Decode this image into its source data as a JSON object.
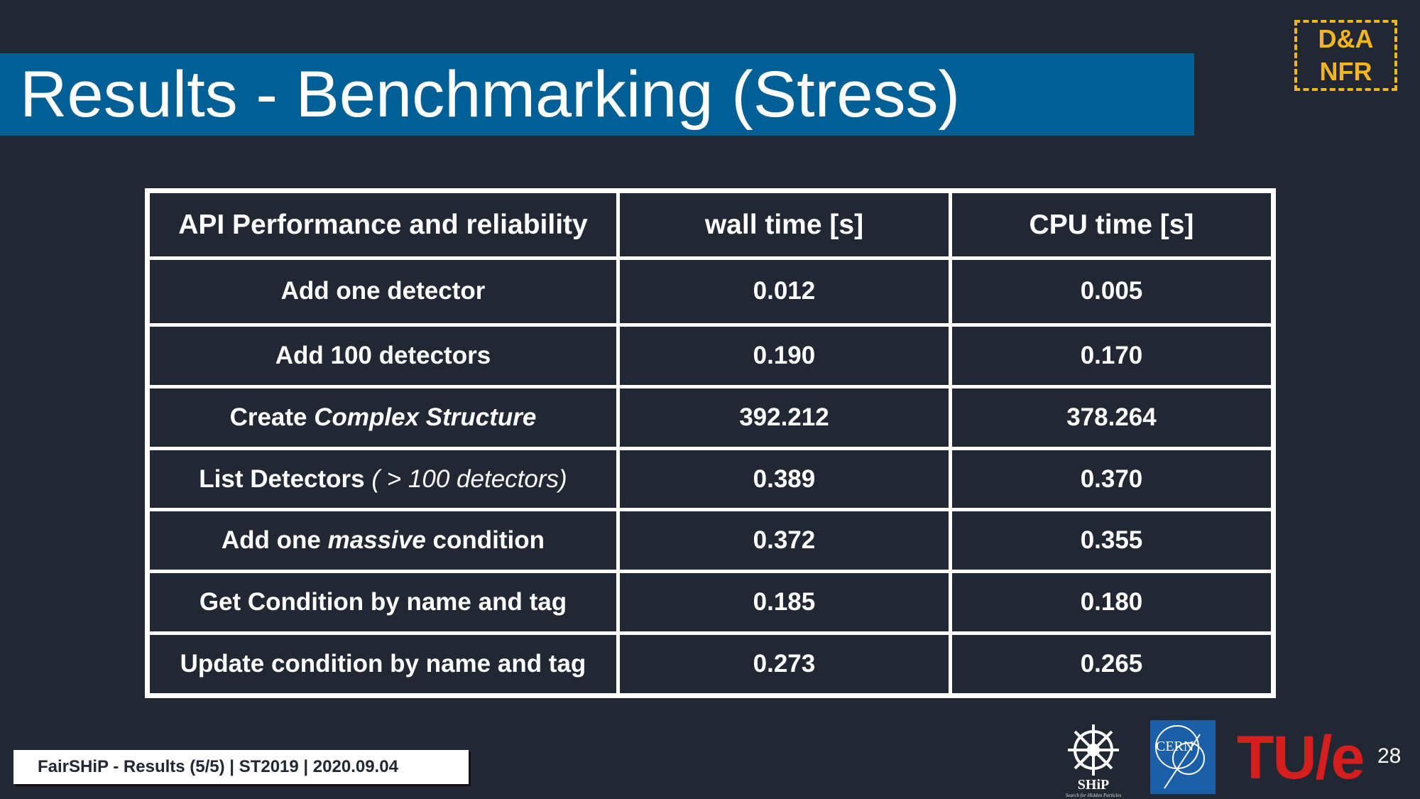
{
  "slide": {
    "title": "Results - Benchmarking (Stress)",
    "badge": {
      "line1": "D&A",
      "line2": "NFR"
    },
    "footer": "FairSHiP - Results (5/5) | ST2019 | 2020.09.04",
    "page_number": "28",
    "colors": {
      "background": "#222833",
      "title_bar": "#005f94",
      "badge": "#f2b51d",
      "tue_red": "#d61e1e",
      "cern_blue": "#1b5fa8"
    }
  },
  "table": {
    "headers": [
      "API Performance and reliability",
      "wall time [s]",
      "CPU time [s]"
    ],
    "rows": [
      {
        "label_parts": [
          "Add one detector"
        ],
        "wall": "0.012",
        "cpu": "0.005"
      },
      {
        "label_parts": [
          "Add 100 detectors"
        ],
        "wall": "0.190",
        "cpu": "0.170"
      },
      {
        "label_parts": [
          "Create ",
          "Complex Structure"
        ],
        "wall": "392.212",
        "cpu": "378.264"
      },
      {
        "label_parts": [
          "List Detectors ",
          "( > 100 detectors)"
        ],
        "wall": "0.389",
        "cpu": "0.370"
      },
      {
        "label_parts": [
          "Add one ",
          "massive",
          " condition"
        ],
        "wall": "0.372",
        "cpu": "0.355"
      },
      {
        "label_parts": [
          "Get Condition by name and tag"
        ],
        "wall": "0.185",
        "cpu": "0.180"
      },
      {
        "label_parts": [
          "Update condition by name and tag"
        ],
        "wall": "0.273",
        "cpu": "0.265"
      }
    ]
  },
  "logos": {
    "ship": {
      "main": "SHiP",
      "sub": "Search for Hidden Particles"
    },
    "cern": "CERN",
    "tue": "TU/e"
  }
}
